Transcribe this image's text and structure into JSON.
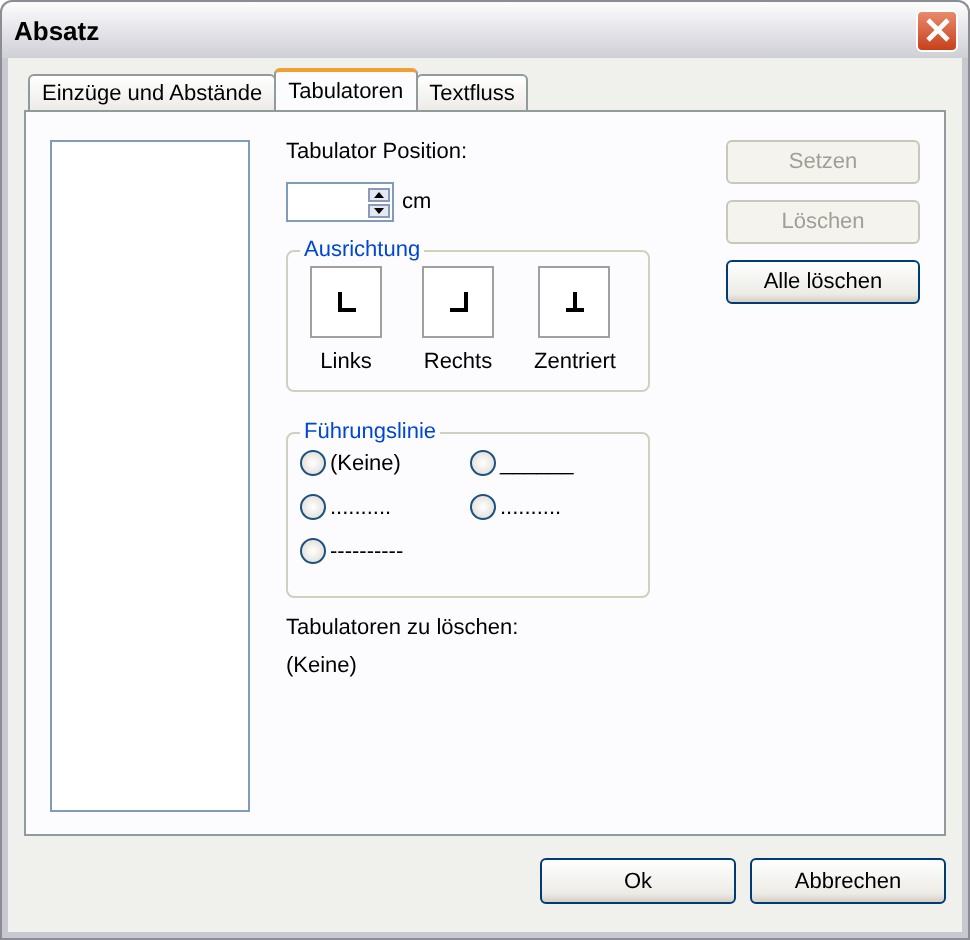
{
  "window": {
    "title": "Absatz"
  },
  "tabs": [
    {
      "label": "Einzüge und Abstände",
      "selected": false
    },
    {
      "label": "Tabulatoren",
      "selected": true
    },
    {
      "label": "Textfluss",
      "selected": false
    }
  ],
  "position": {
    "label": "Tabulator Position:",
    "unit": "cm"
  },
  "alignment": {
    "title": "Ausrichtung",
    "options": [
      {
        "label": "Links",
        "kind": "left"
      },
      {
        "label": "Rechts",
        "kind": "right"
      },
      {
        "label": "Zentriert",
        "kind": "center"
      }
    ]
  },
  "leader": {
    "title": "Führungslinie",
    "options": [
      {
        "label": "(Keine)",
        "selected": false
      },
      {
        "label": "______",
        "selected": false
      },
      {
        "label": "..........",
        "selected": false
      },
      {
        "label": "..........",
        "selected": false
      },
      {
        "label": "----------",
        "selected": false
      }
    ]
  },
  "to_delete": {
    "label": "Tabulatoren zu löschen:",
    "value": "(Keine)"
  },
  "side_buttons": [
    {
      "label": "Setzen",
      "disabled": true
    },
    {
      "label": "Löschen",
      "disabled": true
    },
    {
      "label": "Alle löschen",
      "disabled": false
    }
  ],
  "buttons": [
    {
      "label": "Ok",
      "disabled": false
    },
    {
      "label": "Abbrechen",
      "disabled": false
    }
  ]
}
